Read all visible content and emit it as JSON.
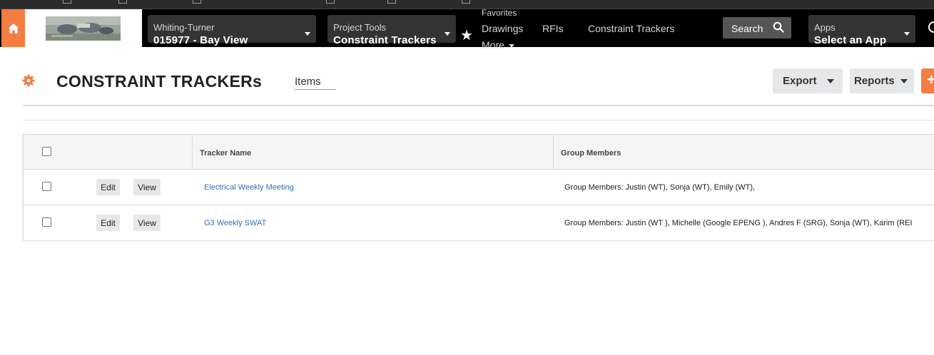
{
  "nav": {
    "company_label": "Whiting-Turner",
    "project_value": "015977 - Bay View",
    "tools_label": "Project Tools",
    "tools_value": "Constraint Trackers",
    "favorites_label": "Favorites",
    "fav_links": [
      "Drawings",
      "RFIs",
      "Constraint Trackers"
    ],
    "more_label": "More",
    "search_label": "Search",
    "apps_label": "Apps",
    "apps_value": "Select an App"
  },
  "header": {
    "title": "CONSTRAINT TRACKERs",
    "tab_items": "Items",
    "export_label": "Export",
    "reports_label": "Reports",
    "add_label": "+"
  },
  "table": {
    "columns": [
      "Tracker Name",
      "Group Members"
    ],
    "rows": [
      {
        "edit_label": "Edit",
        "view_label": "View",
        "tracker_name": "Electrical Weekly Meeting",
        "group_members": "Group Members: Justin (WT), Sonja (WT), Emily (WT),"
      },
      {
        "edit_label": "Edit",
        "view_label": "View",
        "tracker_name": "G3 Weekly SWAT",
        "group_members": "Group Members: Justin (WT ), Michelle (Google EPENG ), Andres F (SRG), Sonja (WT), Karim (REI"
      }
    ]
  },
  "colors": {
    "accent": "#f47e42",
    "nav_bg": "#000000",
    "link": "#3572b0"
  }
}
